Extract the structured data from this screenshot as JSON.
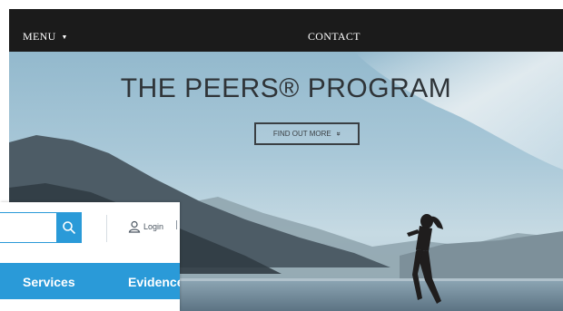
{
  "site": {
    "nav": {
      "menu_label": "MENU",
      "menu_caret": "▼",
      "contact_label": "CONTACT"
    },
    "hero": {
      "title": "THE PEERS® PROGRAM",
      "cta_label": "FIND OUT MORE",
      "cta_icon": "»"
    }
  },
  "overlay": {
    "search_icon": "search-icon",
    "login_label": "Login",
    "nav": {
      "services": "Services",
      "evidence": "Evidence"
    },
    "colors": {
      "accent": "#2a9ad8"
    }
  }
}
